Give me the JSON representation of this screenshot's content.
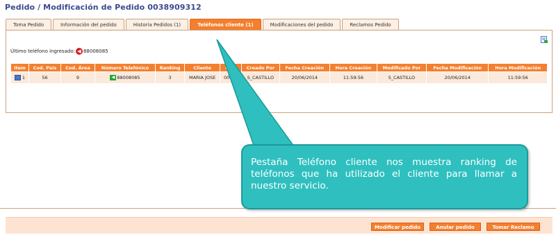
{
  "page": {
    "title": "Pedido / Modificación de Pedido 0038909312"
  },
  "tabs": [
    {
      "label": "Toma Pedido"
    },
    {
      "label": "Información del pedido"
    },
    {
      "label": "Historia Pedidos (1)"
    },
    {
      "label": "Teléfonos cliente (1)",
      "active": true
    },
    {
      "label": "Modificaciones del pedido"
    },
    {
      "label": "Reclamos Pedido"
    }
  ],
  "panel": {
    "last_phone_label": "Último teléfono ingresado:",
    "last_phone_value": "88008085",
    "export_icon": "list-export-icon"
  },
  "table": {
    "headers": [
      "Item",
      "Cod. País",
      "Cod. Área",
      "Número Telefónico",
      "Ranking",
      "Cliente",
      "Codi",
      "Creado Por",
      "Fecha Creación",
      "Hora Creación",
      "Modificado Por",
      "Fecha Modificación",
      "Hora Modificación"
    ],
    "row": {
      "item": "1",
      "cod_pais": "56",
      "cod_area": "9",
      "numero": "88008085",
      "ranking": "3",
      "cliente": "MARIA JOSE",
      "codi": "00129",
      "creado_por": "S_CASTILLO",
      "fecha_creacion": "20/06/2014",
      "hora_creacion": "11:59:56",
      "modificado_por": "S_CASTILLO",
      "fecha_modificacion": "20/06/2014",
      "hora_modificacion": "11:59:56"
    }
  },
  "buttons": {
    "modificar": "Modificar pedido",
    "anular": "Anular pedido",
    "tomar_reclamo": "Tomar Reclamo"
  },
  "callout": {
    "text": "Pestaña Teléfono cliente nos muestra ranking de teléfonos que ha utilizado el cliente para llamar a nuestro servicio."
  },
  "colors": {
    "accent": "#f47f2e",
    "title": "#3a4a8c",
    "callout": "#2fbfbf"
  }
}
